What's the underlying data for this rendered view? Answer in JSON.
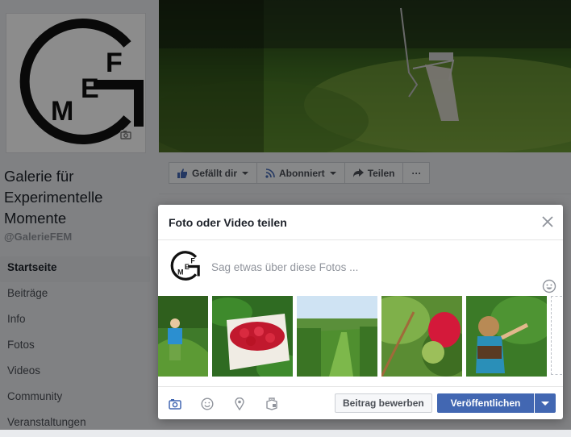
{
  "page": {
    "name": "Galerie für Experimentelle Momente",
    "handle": "@GalerieFEM",
    "logo_letters": [
      "G",
      "M",
      "E",
      "F"
    ]
  },
  "nav": [
    "Startseite",
    "Beiträge",
    "Info",
    "Fotos",
    "Videos",
    "Community",
    "Veranstaltungen"
  ],
  "actions": {
    "like": "Gefällt dir",
    "follow": "Abonniert",
    "share": "Teilen",
    "more": "···"
  },
  "dialog": {
    "title": "Foto oder Video teilen",
    "placeholder": "Sag etwas über diese Fotos ...",
    "photo_count": 5,
    "boost_label": "Beitrag bewerben",
    "publish_label": "Veröffentlichen"
  },
  "colors": {
    "facebook_blue": "#4267b2",
    "background": "#e9ebee"
  }
}
